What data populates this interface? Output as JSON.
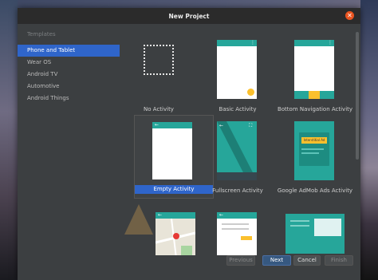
{
  "window": {
    "title": "New Project"
  },
  "sidebar": {
    "header": "Templates",
    "items": [
      "Phone and Tablet",
      "Wear OS",
      "Android TV",
      "Automotive",
      "Android Things"
    ]
  },
  "templates": [
    {
      "label": "No Activity"
    },
    {
      "label": "Basic Activity"
    },
    {
      "label": "Bottom Navigation Activity"
    },
    {
      "label": "Empty Activity"
    },
    {
      "label": "Fullscreen Activity"
    },
    {
      "label": "Google AdMob Ads Activity"
    }
  ],
  "admob": {
    "banner": "Interstitial Ad"
  },
  "footer": {
    "previous": "Previous",
    "next": "Next",
    "cancel": "Cancel",
    "finish": "Finish"
  },
  "colors": {
    "accent": "#26a69a",
    "fab": "#fbc02d",
    "selection": "#2f65ca",
    "close": "#e95420"
  }
}
